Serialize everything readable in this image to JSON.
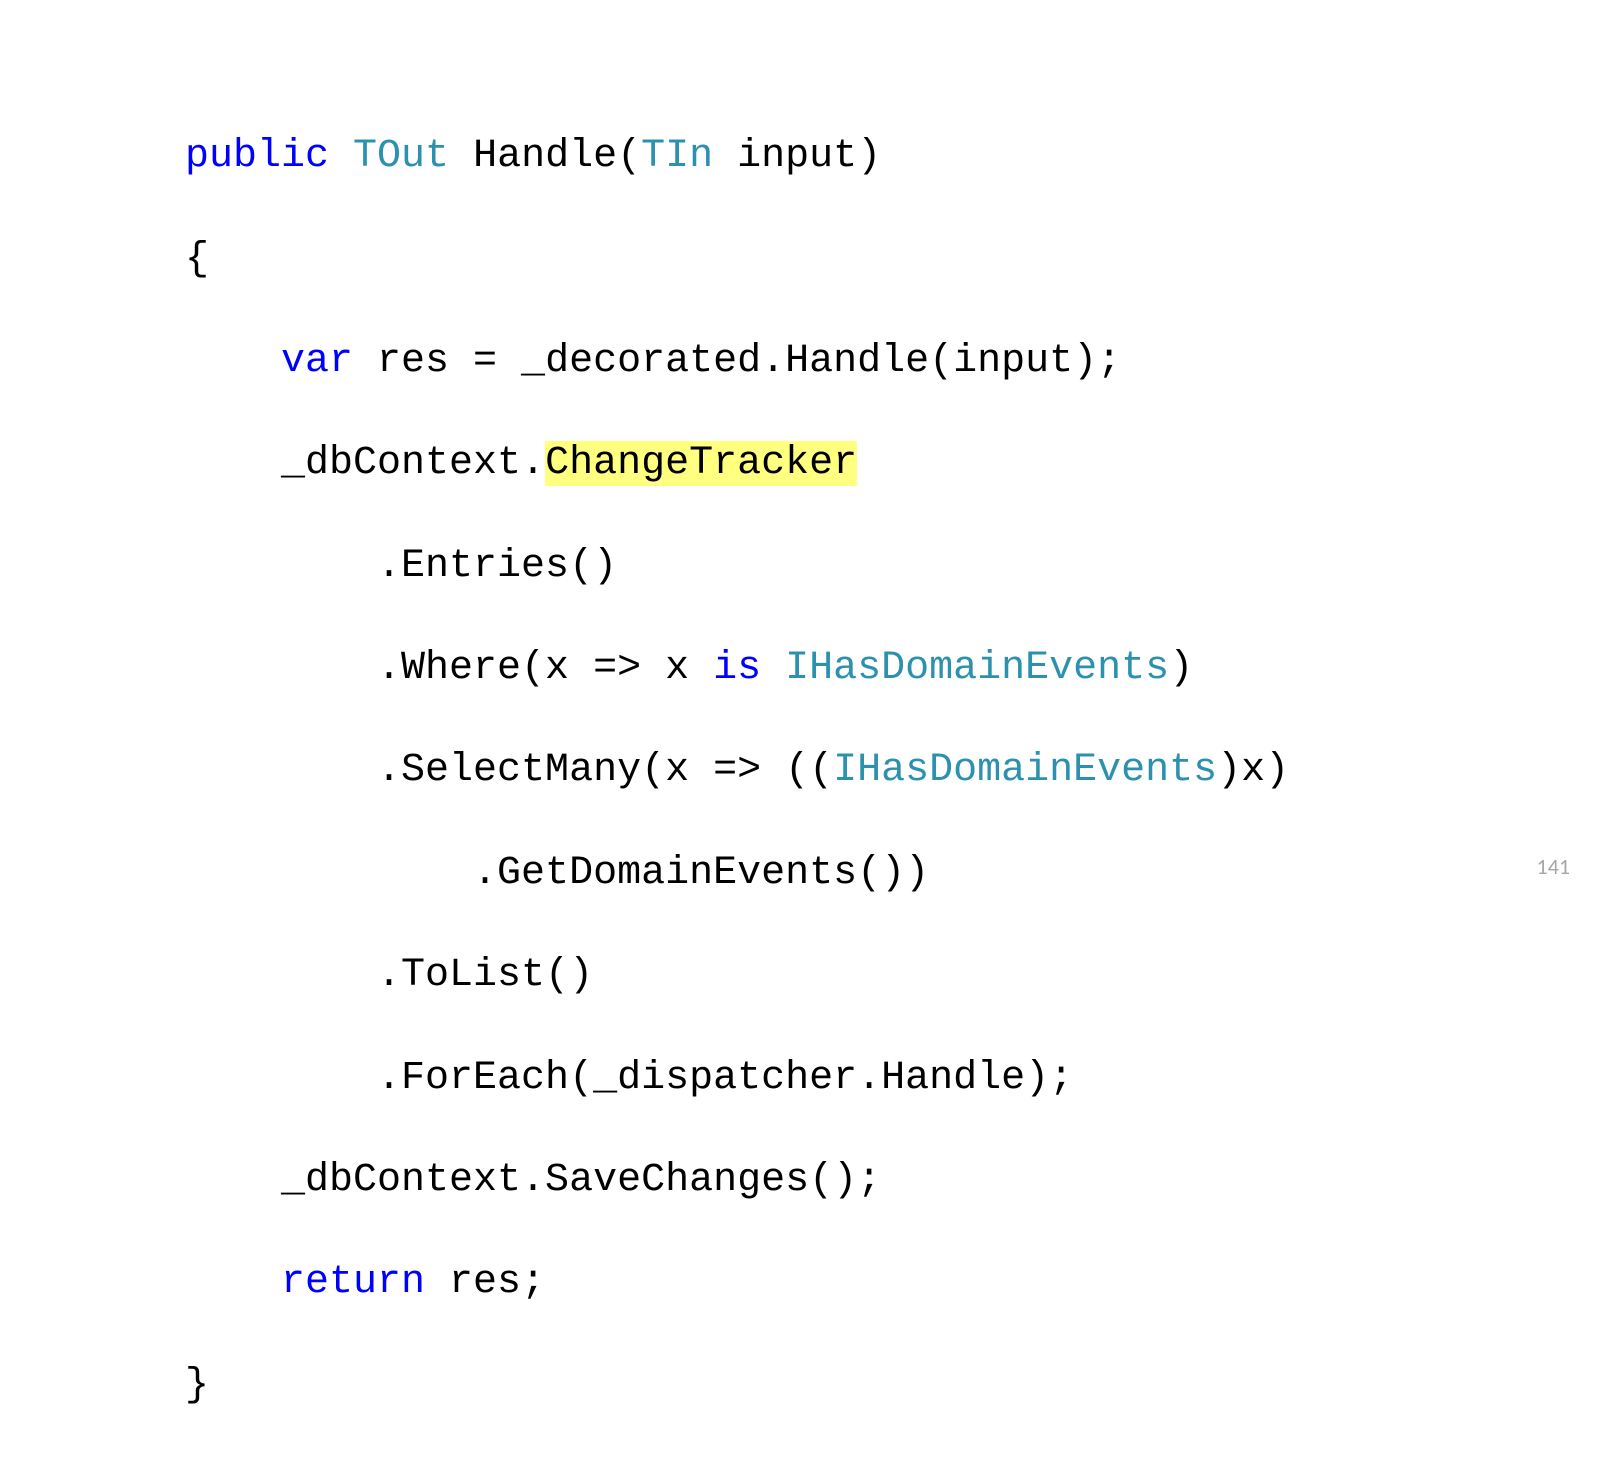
{
  "code": {
    "line1": {
      "kw_public": "public",
      "type_tout": "TOut",
      "method_name": " Handle(",
      "type_tin": "TIn",
      "rest": " input)"
    },
    "line2": "{",
    "line3": {
      "indent": "    ",
      "kw_var": "var",
      "rest": " res = _decorated.Handle(input);"
    },
    "line4": {
      "indent": "    ",
      "pre": "_dbContext.",
      "highlighted": "ChangeTracker"
    },
    "line5": "        .Entries()",
    "line6": {
      "indent": "        ",
      "pre": ".Where(x => x ",
      "kw_is": "is",
      "space": " ",
      "type": "IHasDomainEvents",
      "rest": ")"
    },
    "line7": {
      "indent": "        ",
      "pre": ".SelectMany(x => ((",
      "type": "IHasDomainEvents",
      "rest": ")x)"
    },
    "line8": "            .GetDomainEvents())",
    "line9": "        .ToList()",
    "line10": "        .ForEach(_dispatcher.Handle);",
    "line11": "    _dbContext.SaveChanges();",
    "line12": {
      "indent": "    ",
      "kw_return": "return",
      "rest": " res;"
    },
    "line13": "}"
  },
  "page_number": "141"
}
